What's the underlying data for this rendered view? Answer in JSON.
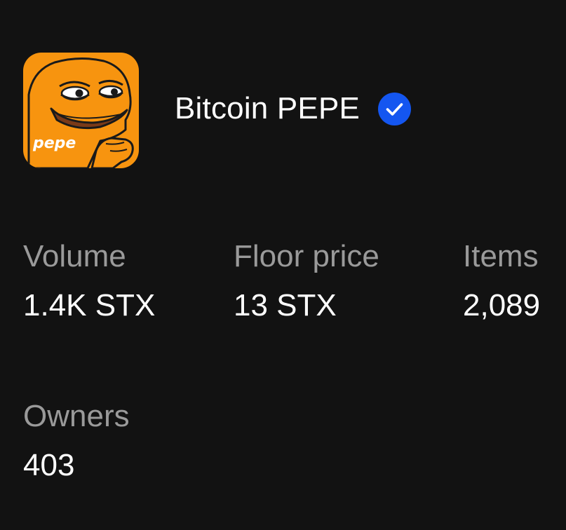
{
  "collection": {
    "name": "Bitcoin PEPE",
    "verified": true,
    "avatar_text": "pepe",
    "avatar_icon": "pepe-frog-logo",
    "verified_icon": "verified-check-badge",
    "colors": {
      "background": "#121212",
      "avatar_bg": "#f7940f",
      "verified_badge": "#1456f0",
      "label": "#9a9a9a",
      "value": "#ffffff"
    }
  },
  "stats": {
    "volume": {
      "label": "Volume",
      "value": "1.4K STX"
    },
    "floor_price": {
      "label": "Floor price",
      "value": "13 STX"
    },
    "items": {
      "label": "Items",
      "value": "2,089"
    },
    "owners": {
      "label": "Owners",
      "value": "403"
    }
  }
}
